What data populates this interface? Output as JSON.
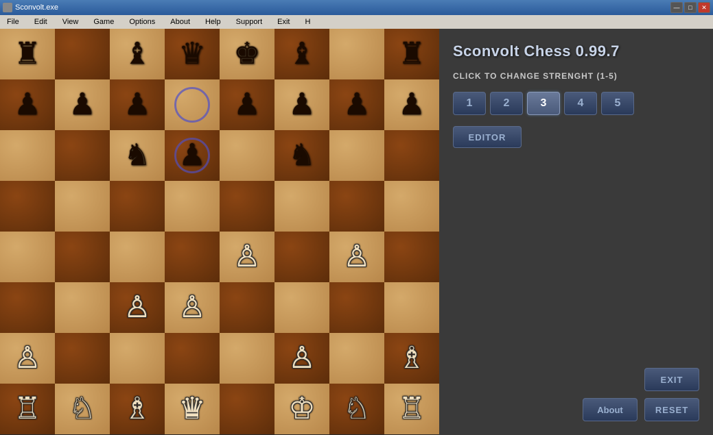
{
  "titleBar": {
    "title": "Sconvolt.exe",
    "minimizeLabel": "—",
    "maximizeLabel": "□",
    "closeLabel": "✕"
  },
  "menuBar": {
    "items": [
      "File",
      "Edit",
      "View",
      "Game",
      "Options",
      "About",
      "Help",
      "Support",
      "Exit",
      "H"
    ]
  },
  "appTitle": "Sconvolt Chess 0.99.7",
  "strengthLabel": "CLICK TO CHANGE STRENGHT (1-5)",
  "strengthButtons": [
    "1",
    "2",
    "3",
    "4",
    "5"
  ],
  "activeStrength": 2,
  "editorLabel": "EDITOR",
  "exitLabel": "EXIT",
  "aboutLabel": "About",
  "resetLabel": "RESET",
  "board": {
    "rows": 8,
    "cols": 8,
    "pieces": [
      {
        "row": 0,
        "col": 0,
        "piece": "♜",
        "type": "black"
      },
      {
        "row": 0,
        "col": 2,
        "piece": "♝",
        "type": "black"
      },
      {
        "row": 0,
        "col": 3,
        "piece": "♛",
        "type": "black"
      },
      {
        "row": 0,
        "col": 4,
        "piece": "♚",
        "type": "black"
      },
      {
        "row": 0,
        "col": 5,
        "piece": "♝",
        "type": "black"
      },
      {
        "row": 0,
        "col": 7,
        "piece": "♜",
        "type": "black"
      },
      {
        "row": 1,
        "col": 0,
        "piece": "♟",
        "type": "black"
      },
      {
        "row": 1,
        "col": 1,
        "piece": "♟",
        "type": "black"
      },
      {
        "row": 1,
        "col": 2,
        "piece": "♟",
        "type": "black"
      },
      {
        "row": 1,
        "col": 3,
        "piece": "circle",
        "type": "highlight"
      },
      {
        "row": 1,
        "col": 4,
        "piece": "♟",
        "type": "black"
      },
      {
        "row": 1,
        "col": 5,
        "piece": "♟",
        "type": "black"
      },
      {
        "row": 1,
        "col": 6,
        "piece": "♟",
        "type": "black"
      },
      {
        "row": 1,
        "col": 7,
        "piece": "♟",
        "type": "black"
      },
      {
        "row": 2,
        "col": 2,
        "piece": "♞",
        "type": "black"
      },
      {
        "row": 2,
        "col": 3,
        "piece": "circle",
        "type": "highlight2"
      },
      {
        "row": 2,
        "col": 5,
        "piece": "♞",
        "type": "black"
      },
      {
        "row": 4,
        "col": 4,
        "piece": "♙",
        "type": "white"
      },
      {
        "row": 4,
        "col": 6,
        "piece": "♙",
        "type": "white"
      },
      {
        "row": 5,
        "col": 2,
        "piece": "♙",
        "type": "white"
      },
      {
        "row": 5,
        "col": 3,
        "piece": "♙",
        "type": "white"
      },
      {
        "row": 6,
        "col": 0,
        "piece": "♙",
        "type": "white"
      },
      {
        "row": 6,
        "col": 5,
        "piece": "♙",
        "type": "white"
      },
      {
        "row": 6,
        "col": 7,
        "piece": "♗",
        "type": "white"
      },
      {
        "row": 7,
        "col": 0,
        "piece": "♖",
        "type": "white"
      },
      {
        "row": 7,
        "col": 1,
        "piece": "♘",
        "type": "white"
      },
      {
        "row": 7,
        "col": 2,
        "piece": "♗",
        "type": "white"
      },
      {
        "row": 7,
        "col": 3,
        "piece": "♛",
        "type": "white"
      },
      {
        "row": 7,
        "col": 5,
        "piece": "♔",
        "type": "white"
      },
      {
        "row": 7,
        "col": 6,
        "piece": "♘",
        "type": "white"
      },
      {
        "row": 7,
        "col": 7,
        "piece": "♖",
        "type": "white"
      }
    ]
  }
}
